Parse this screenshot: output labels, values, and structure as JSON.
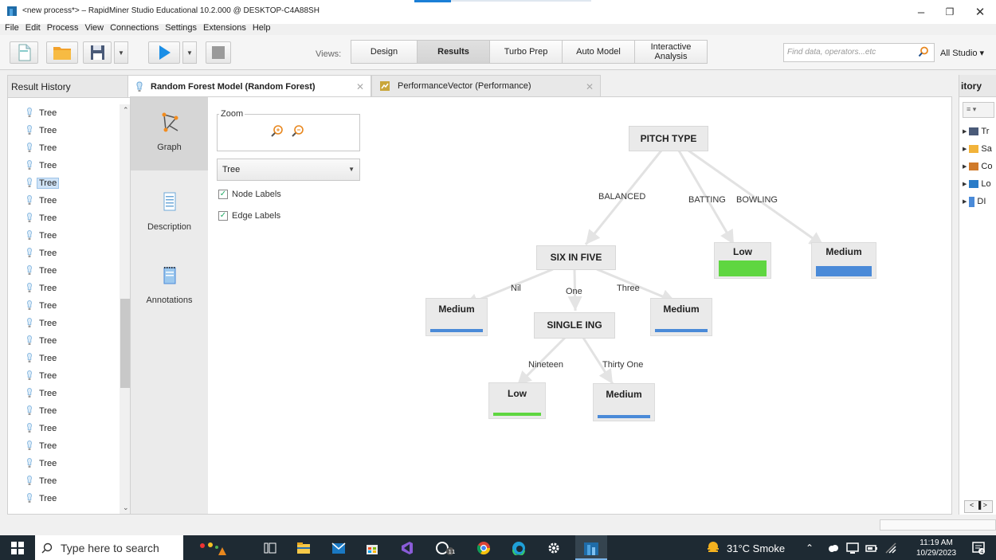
{
  "window": {
    "title": "<new process*> – RapidMiner Studio Educational 10.2.000 @ DESKTOP-C4A88SH",
    "minimize": "–",
    "maximize": "❐",
    "close": "✕"
  },
  "menu": [
    "File",
    "Edit",
    "Process",
    "View",
    "Connections",
    "Settings",
    "Extensions",
    "Help"
  ],
  "toolbar": {
    "views_label": "Views:",
    "views": [
      {
        "label": "Design",
        "active": false
      },
      {
        "label": "Results",
        "active": true
      },
      {
        "label": "Turbo Prep",
        "active": false
      },
      {
        "label": "Auto Model",
        "active": false
      },
      {
        "label": "Interactive Analysis",
        "active": false
      }
    ],
    "search_placeholder": "Find data, operators...etc",
    "all_studio": "All Studio ▾"
  },
  "result_history": {
    "header": "Result History",
    "items": [
      "Tree",
      "Tree",
      "Tree",
      "Tree",
      "Tree",
      "Tree",
      "Tree",
      "Tree",
      "Tree",
      "Tree",
      "Tree",
      "Tree",
      "Tree",
      "Tree",
      "Tree",
      "Tree",
      "Tree",
      "Tree",
      "Tree",
      "Tree",
      "Tree",
      "Tree",
      "Tree"
    ],
    "selected_index": 4
  },
  "tabs": [
    {
      "label": "Random Forest Model (Random Forest)",
      "active": true
    },
    {
      "label": "PerformanceVector (Performance)",
      "active": false
    }
  ],
  "side_views": [
    {
      "label": "Graph",
      "active": true
    },
    {
      "label": "Description",
      "active": false
    },
    {
      "label": "Annotations",
      "active": false
    }
  ],
  "graph_controls": {
    "zoom_label": "Zoom",
    "select_value": "Tree",
    "node_labels": "Node Labels",
    "edge_labels": "Edge Labels"
  },
  "tree": {
    "root": "PITCH TYPE",
    "node_six": "SIX IN FIVE",
    "node_single": "SINGLE ING",
    "edge_balanced": "BALANCED",
    "edge_batting": "BATTING",
    "edge_bowling": "BOWLING",
    "edge_nil": "Nil",
    "edge_one": "One",
    "edge_three": "Three",
    "edge_nineteen": "Nineteen",
    "edge_thirty_one": "Thirty One",
    "leaf_batting": "Low",
    "leaf_bowling": "Medium",
    "leaf_nil": "Medium",
    "leaf_three": "Medium",
    "leaf_nineteen": "Low",
    "leaf_thirty_one": "Medium",
    "colors": {
      "low": "#5fd641",
      "medium": "#4a8ad8"
    }
  },
  "repository": {
    "header": "itory",
    "items": [
      "Tr",
      "Sa",
      "Co",
      "Lo",
      "DI"
    ]
  },
  "taskbar": {
    "search_text": "Type here to search",
    "weather": "31°C  Smoke",
    "time": "11:19 AM",
    "date": "10/29/2023"
  }
}
